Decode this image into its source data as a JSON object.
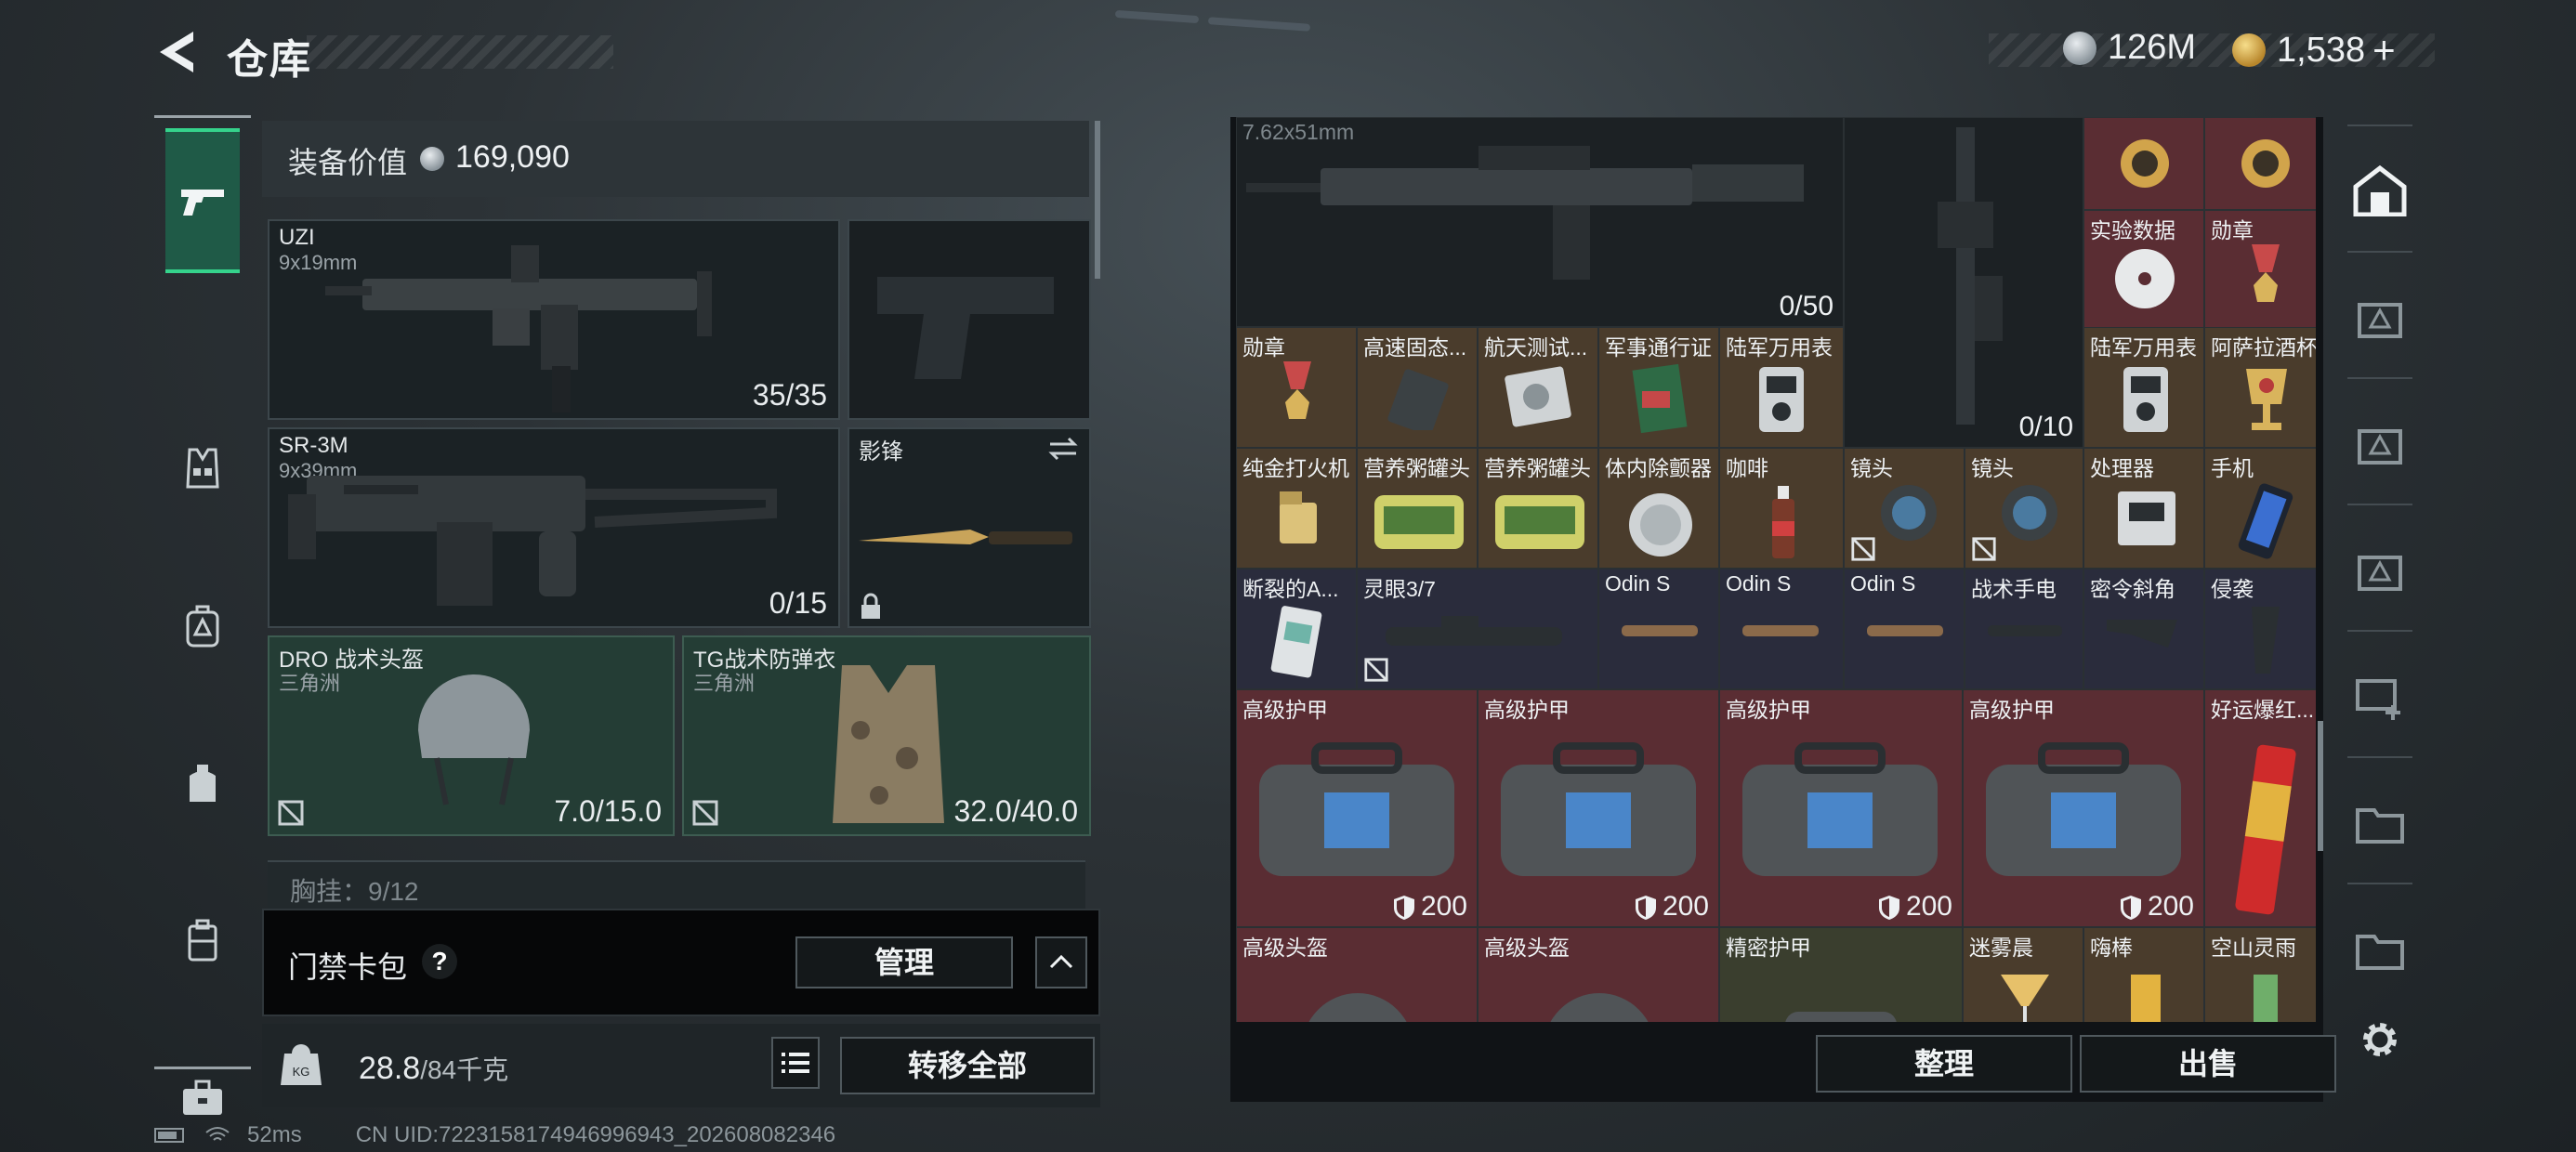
{
  "header": {
    "title": "仓库",
    "currencies": [
      {
        "icon": "silver-coin-icon",
        "value": "126M"
      },
      {
        "icon": "gold-coin-icon",
        "value": "1,538"
      }
    ],
    "add_symbol": "+"
  },
  "equipment": {
    "value_label": "装备价值",
    "value": "169,090",
    "primary": {
      "name": "UZI",
      "caliber": "9x19mm",
      "ammo": "35/35"
    },
    "secondary": {
      "name": "SR-3M",
      "caliber": "9x39mm",
      "ammo": "0/15"
    },
    "melee": {
      "name": "影锋"
    },
    "helmet": {
      "name": "DRO 战术头盔",
      "origin": "三角洲",
      "durability": "7.0/15.0"
    },
    "armor": {
      "name": "TG战术防弹衣",
      "origin": "三角洲",
      "durability": "32.0/40.0"
    },
    "chest_rig": {
      "label": "胸挂：9/12",
      "icon": "question-icon"
    },
    "card_wallet": {
      "label": "门禁卡包",
      "help": "?",
      "manage_label": "管理"
    },
    "weight": {
      "current": "28.8",
      "max": "/84千克"
    },
    "transfer_all_label": "转移全部"
  },
  "stash": {
    "top_caliber": "7.62x51mm",
    "rifle1_ammo": "0/50",
    "rifle2_ammo": "0/10",
    "items": [
      {
        "id": "gold-watch-1",
        "name": ""
      },
      {
        "id": "gold-watch-2",
        "name": ""
      },
      {
        "id": "lab-data",
        "name": "实验数据"
      },
      {
        "id": "medal-1",
        "name": "勋章"
      },
      {
        "id": "medal-2",
        "name": "勋章"
      },
      {
        "id": "ssd",
        "name": "高速固态..."
      },
      {
        "id": "aerospace-disk",
        "name": "航天测试..."
      },
      {
        "id": "military-pass",
        "name": "军事通行证"
      },
      {
        "id": "army-watch-1",
        "name": "陆军万用表"
      },
      {
        "id": "army-watch-2",
        "name": "陆军万用表"
      },
      {
        "id": "arabic-cup",
        "name": "阿萨拉酒杯"
      },
      {
        "id": "gold-lighter",
        "name": "纯金打火机"
      },
      {
        "id": "porridge-1",
        "name": "营养粥罐头"
      },
      {
        "id": "porridge-2",
        "name": "营养粥罐头"
      },
      {
        "id": "defib",
        "name": "体内除颤器"
      },
      {
        "id": "coffee",
        "name": "咖啡"
      },
      {
        "id": "lens-1",
        "name": "镜头"
      },
      {
        "id": "lens-2",
        "name": "镜头"
      },
      {
        "id": "processor",
        "name": "处理器"
      },
      {
        "id": "phone",
        "name": "手机"
      },
      {
        "id": "broken-a",
        "name": "断裂的A..."
      },
      {
        "id": "scope",
        "name": "灵眼3/7"
      },
      {
        "id": "odin-1",
        "name": "Odin S"
      },
      {
        "id": "odin-2",
        "name": "Odin S"
      },
      {
        "id": "odin-3",
        "name": "Odin S"
      },
      {
        "id": "flashlight",
        "name": "战术手电"
      },
      {
        "id": "grip",
        "name": "密令斜角"
      },
      {
        "id": "raid",
        "name": "侵袭"
      },
      {
        "id": "armor-1",
        "name": "高级护甲",
        "value": "200"
      },
      {
        "id": "armor-2",
        "name": "高级护甲",
        "value": "200"
      },
      {
        "id": "armor-3",
        "name": "高级护甲",
        "value": "200"
      },
      {
        "id": "armor-4",
        "name": "高级护甲",
        "value": "200"
      },
      {
        "id": "firecracker",
        "name": "好运爆红..."
      },
      {
        "id": "helmet-1",
        "name": "高级头盔"
      },
      {
        "id": "helmet-2",
        "name": "高级头盔"
      },
      {
        "id": "precision-armor",
        "name": "精密护甲"
      },
      {
        "id": "cocktail-1",
        "name": "迷雾晨"
      },
      {
        "id": "cocktail-2",
        "name": "嗨棒"
      },
      {
        "id": "cocktail-3",
        "name": "空山灵雨"
      }
    ],
    "sort_label": "整理",
    "sell_label": "出售"
  },
  "status": {
    "ping": "52ms",
    "uid": "CN UID:7223158174946996943_202608082346"
  }
}
